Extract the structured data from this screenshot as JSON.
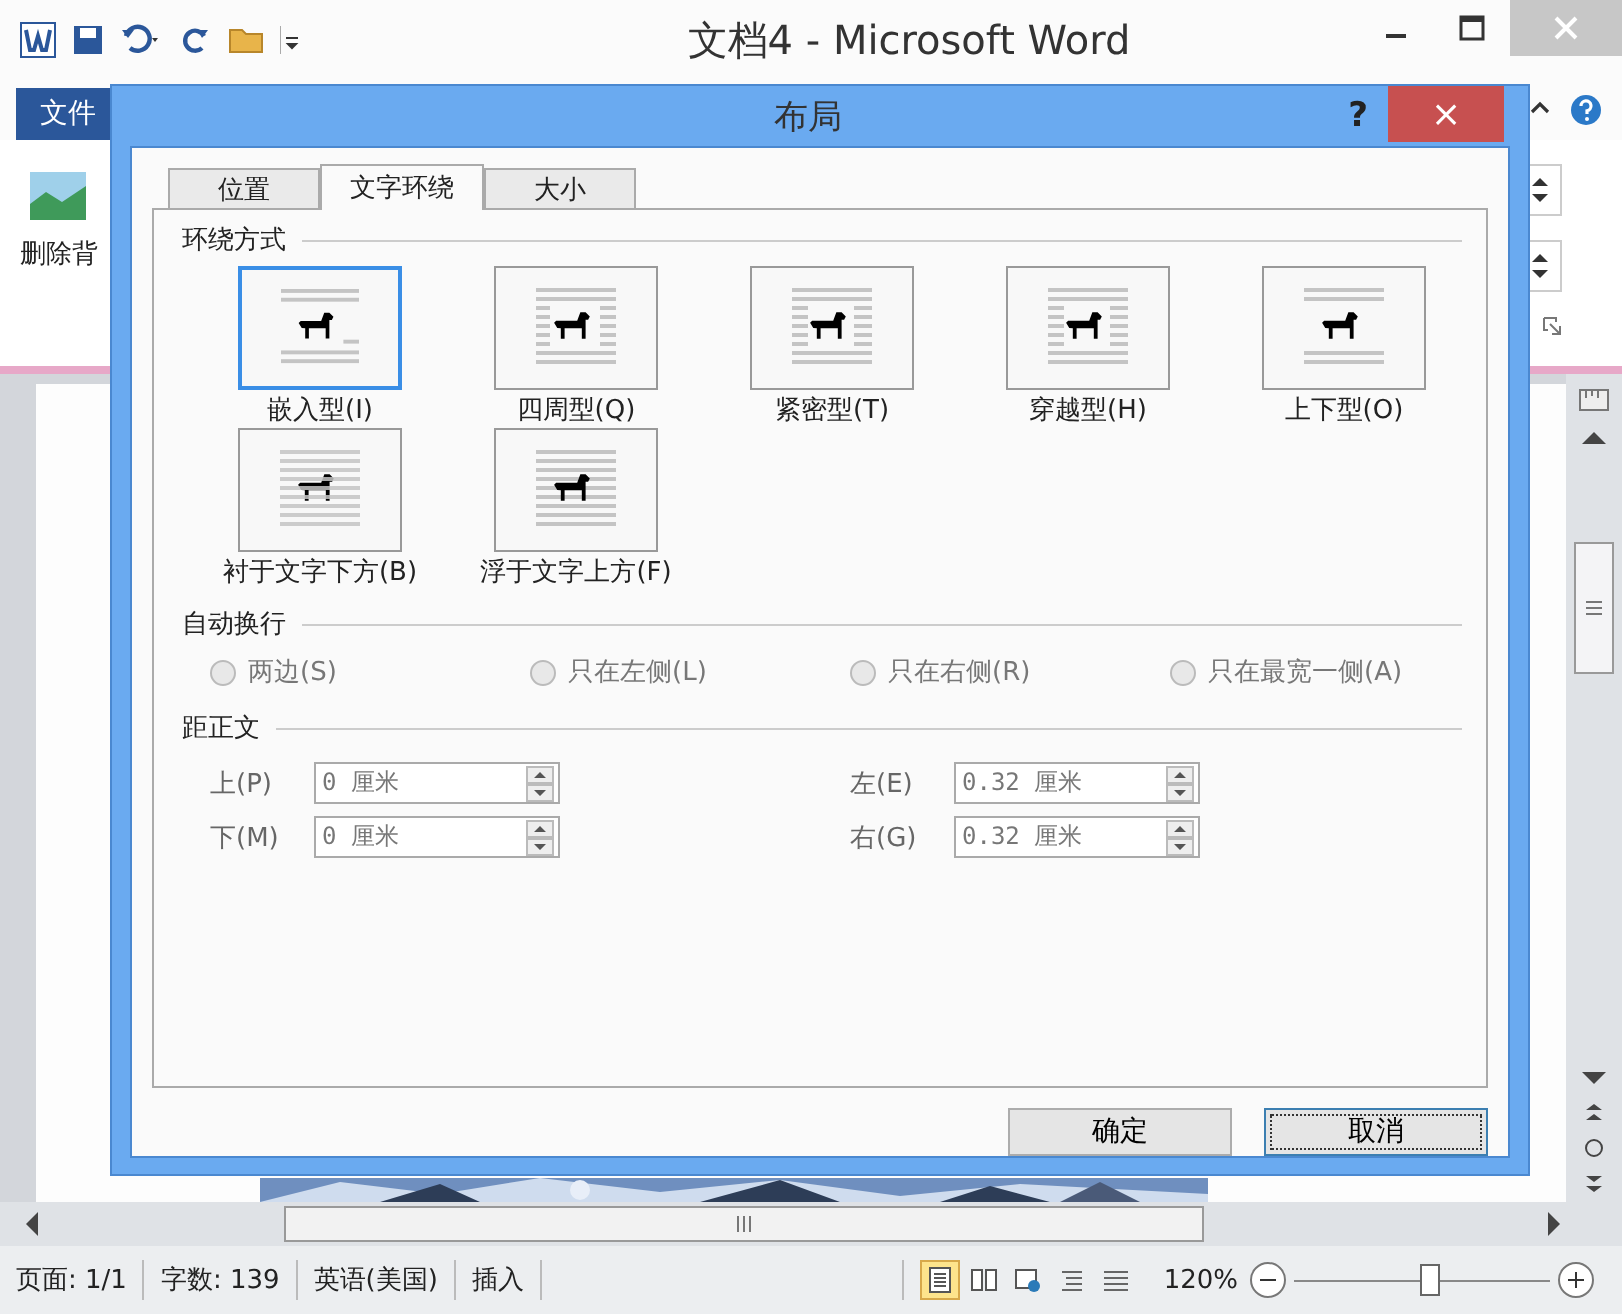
{
  "app": {
    "title": "文档4 - Microsoft Word",
    "file_tab": "文件",
    "ribbon_label": "删除背"
  },
  "dialog": {
    "title": "布局",
    "help": "?",
    "close": "×",
    "tabs": [
      {
        "label": "位置",
        "selected": false
      },
      {
        "label": "文字环绕",
        "selected": true
      },
      {
        "label": "大小",
        "selected": false
      }
    ],
    "wrap_section": "环绕方式",
    "wrap_styles": [
      {
        "label": "嵌入型(I)",
        "kind": "inline",
        "selected": true
      },
      {
        "label": "四周型(Q)",
        "kind": "square",
        "selected": false
      },
      {
        "label": "紧密型(T)",
        "kind": "tight",
        "selected": false
      },
      {
        "label": "穿越型(H)",
        "kind": "through",
        "selected": false
      },
      {
        "label": "上下型(O)",
        "kind": "topbottom",
        "selected": false
      },
      {
        "label": "衬于文字下方(B)",
        "kind": "behind",
        "selected": false
      },
      {
        "label": "浮于文字上方(F)",
        "kind": "front",
        "selected": false
      }
    ],
    "auto_wrap_section": "自动换行",
    "auto_wrap_options": [
      {
        "label": "两边(S)",
        "selected": false,
        "disabled": true
      },
      {
        "label": "只在左侧(L)",
        "selected": false,
        "disabled": true
      },
      {
        "label": "只在右侧(R)",
        "selected": false,
        "disabled": true
      },
      {
        "label": "只在最宽一侧(A)",
        "selected": false,
        "disabled": true
      }
    ],
    "distance_section": "距正文",
    "distances": [
      {
        "label": "上(P)",
        "value": "0 厘米",
        "disabled": true
      },
      {
        "label": "左(E)",
        "value": "0.32 厘米",
        "disabled": true
      },
      {
        "label": "下(M)",
        "value": "0 厘米",
        "disabled": true
      },
      {
        "label": "右(G)",
        "value": "0.32 厘米",
        "disabled": true
      }
    ],
    "buttons": [
      {
        "label": "确定",
        "focused": false
      },
      {
        "label": "取消",
        "focused": true
      }
    ]
  },
  "status_bar": {
    "items": [
      "页面: 1/1",
      "字数: 139",
      "英语(美国)",
      "插入"
    ],
    "views": [
      {
        "selected": true
      },
      {
        "selected": false
      },
      {
        "selected": false
      },
      {
        "selected": false
      },
      {
        "selected": false
      }
    ],
    "zoom": "120%",
    "zoom_slider": {
      "level": 0.52
    }
  }
}
